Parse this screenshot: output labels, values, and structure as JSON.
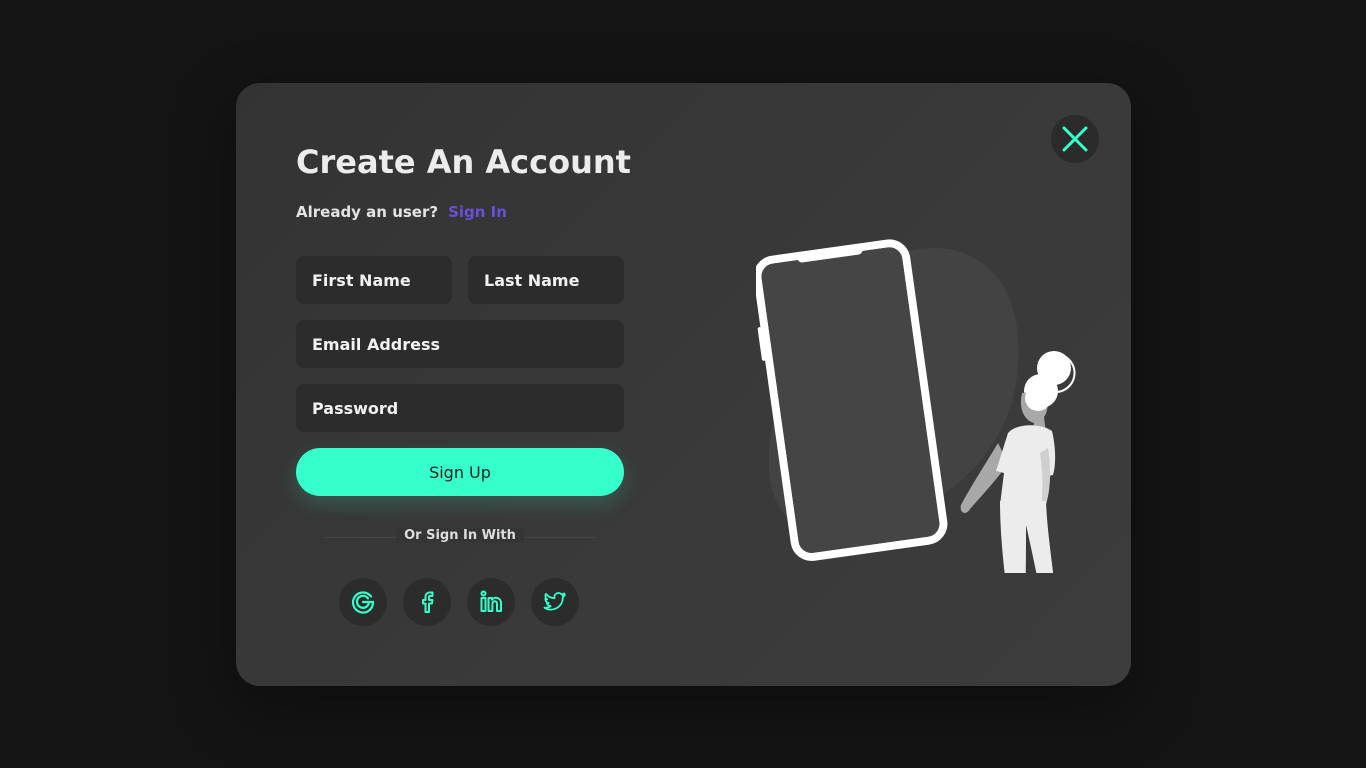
{
  "header": {
    "title": "Create An Account",
    "subtitle": "Already an user?",
    "signin_link": "Sign In"
  },
  "form": {
    "first_name_label": "First Name",
    "last_name_label": "Last Name",
    "email_label": "Email Address",
    "password_label": "Password",
    "submit_label": "Sign Up"
  },
  "social": {
    "divider_label": "Or Sign In With",
    "providers": [
      {
        "name": "google-icon"
      },
      {
        "name": "facebook-icon"
      },
      {
        "name": "linkedin-icon"
      },
      {
        "name": "twitter-icon"
      }
    ]
  },
  "icons": {
    "close": "close-icon"
  },
  "colors": {
    "accent": "#35ffcb",
    "link": "#6a4fdc",
    "background": "#141414",
    "modal": "#383838",
    "field": "#2c2c2c"
  }
}
